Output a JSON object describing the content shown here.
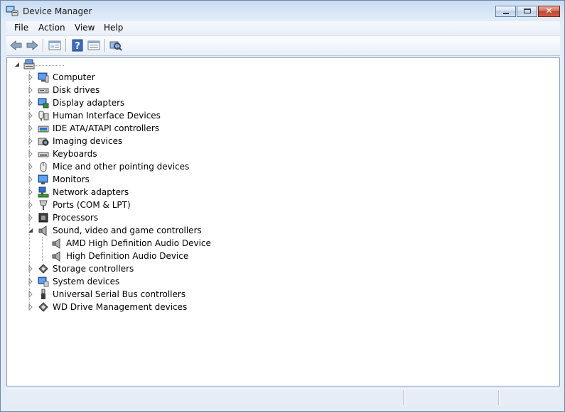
{
  "window": {
    "title": "Device Manager",
    "app_icon": "device-manager-icon"
  },
  "caption_buttons": {
    "minimize": "minimize-icon",
    "maximize": "maximize-icon",
    "close": "close-icon",
    "close_glyph": "✕"
  },
  "menu": {
    "items": [
      {
        "label": "File"
      },
      {
        "label": "Action"
      },
      {
        "label": "View"
      },
      {
        "label": "Help"
      }
    ]
  },
  "toolbar": {
    "icons": [
      "back-arrow-icon",
      "forward-arrow-icon",
      "show-hide-console-tree-icon",
      "help-icon",
      "properties-icon",
      "scan-hardware-changes-icon"
    ]
  },
  "tree": {
    "root": {
      "icon": "computer-root-icon",
      "label": "",
      "expanded": true
    },
    "categories": [
      {
        "label": "Computer",
        "icon": "computer-icon"
      },
      {
        "label": "Disk drives",
        "icon": "disk-drive-icon"
      },
      {
        "label": "Display adapters",
        "icon": "display-adapter-icon"
      },
      {
        "label": "Human Interface Devices",
        "icon": "hid-icon"
      },
      {
        "label": "IDE ATA/ATAPI controllers",
        "icon": "ide-controller-icon"
      },
      {
        "label": "Imaging devices",
        "icon": "camera-icon"
      },
      {
        "label": "Keyboards",
        "icon": "keyboard-icon"
      },
      {
        "label": "Mice and other pointing devices",
        "icon": "mouse-icon"
      },
      {
        "label": "Monitors",
        "icon": "monitor-icon"
      },
      {
        "label": "Network adapters",
        "icon": "network-adapter-icon"
      },
      {
        "label": "Ports (COM & LPT)",
        "icon": "port-icon"
      },
      {
        "label": "Processors",
        "icon": "processor-icon"
      },
      {
        "label": "Sound, video and game controllers",
        "icon": "speaker-icon",
        "expanded": true,
        "children": [
          {
            "label": "AMD High Definition Audio Device",
            "icon": "speaker-icon"
          },
          {
            "label": "High Definition Audio Device",
            "icon": "speaker-icon"
          }
        ]
      },
      {
        "label": "Storage controllers",
        "icon": "storage-controller-icon"
      },
      {
        "label": "System devices",
        "icon": "system-device-icon"
      },
      {
        "label": "Universal Serial Bus controllers",
        "icon": "usb-icon"
      },
      {
        "label": "WD Drive Management devices",
        "icon": "wd-drive-icon"
      }
    ]
  },
  "status": {
    "sections": [
      "",
      "",
      ""
    ]
  },
  "colors": {
    "accent": "#1f4f8b",
    "title_bar": "#c9dcf1",
    "close_red": "#c0442a"
  }
}
